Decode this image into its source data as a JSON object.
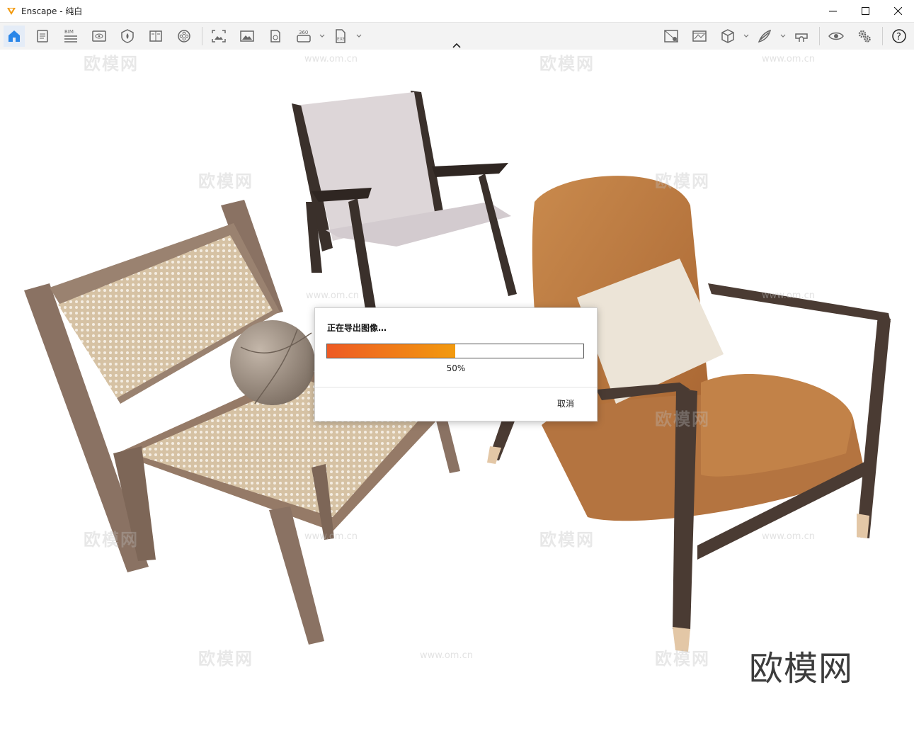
{
  "window": {
    "title": "Enscape - 纯白",
    "accent": "#f29a0e"
  },
  "toolbar": {
    "left_icons": [
      "home-icon",
      "project-notes-icon",
      "bim-icon",
      "view-management-icon",
      "visual-settings-icon",
      "book-icon",
      "reel-icon"
    ],
    "mid_icons": [
      "screenshot-icon",
      "image-icon",
      "vr-icon",
      "panorama-360-icon",
      "exe-export-icon"
    ],
    "right_icons": [
      "asset-library-icon",
      "material-icon",
      "cube-icon",
      "grass-icon",
      "headset-icon",
      "eye-icon",
      "settings-icon",
      "help-icon"
    ],
    "bim_label": "BIM",
    "panorama_label": "360",
    "exe_label": "EXE"
  },
  "dialog": {
    "title": "正在导出图像…",
    "progress": 0.5,
    "progress_label": "50%",
    "cancel_label": "取消"
  },
  "watermark": {
    "text": "欧模网",
    "url": "www.om.cn",
    "brand": "欧模网"
  }
}
